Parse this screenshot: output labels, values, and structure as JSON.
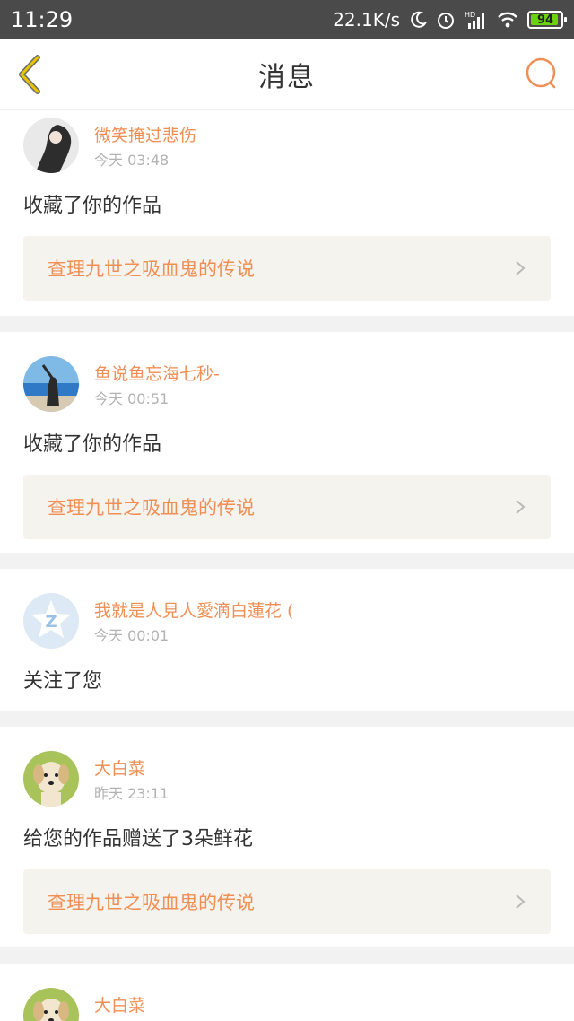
{
  "status": {
    "time": "11:29",
    "net_speed": "22.1K/s",
    "battery": "94"
  },
  "header": {
    "title": "消息"
  },
  "messages": [
    {
      "name": "微笑掩过悲伤",
      "time": "今天 03:48",
      "action": "收藏了你的作品",
      "work": "查理九世之吸血鬼的传说"
    },
    {
      "name": "鱼说鱼忘海七秒-",
      "time": "今天 00:51",
      "action": "收藏了你的作品",
      "work": "查理九世之吸血鬼的传说"
    },
    {
      "name": "我就是人見人愛滴白蓮花 (",
      "time": "今天 00:01",
      "action": "关注了您"
    },
    {
      "name": "大白菜",
      "time": "昨天 23:11",
      "action": "给您的作品赠送了3朵鲜花",
      "work": "查理九世之吸血鬼的传说"
    },
    {
      "name": "大白菜"
    }
  ],
  "colors": {
    "accent": "#f08f55",
    "back_arrow": "#e8c400"
  }
}
